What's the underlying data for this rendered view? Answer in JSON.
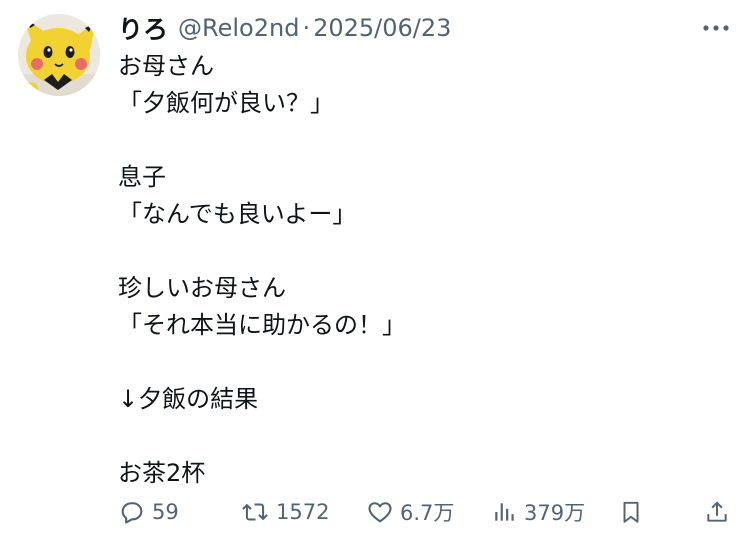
{
  "user": {
    "display_name": "りろ",
    "handle": "@Relo2nd",
    "separator": "·",
    "date": "2025/06/23"
  },
  "tweet": {
    "paragraphs": [
      [
        "お母さん",
        "「夕飯何が良い？」"
      ],
      [
        "息子",
        "「なんでも良いよー」"
      ],
      [
        "珍しいお母さん",
        "「それ本当に助かるの！」"
      ],
      [
        "↓夕飯の結果"
      ],
      [
        "お茶2杯"
      ]
    ]
  },
  "actions": {
    "replies": "59",
    "retweets": "1572",
    "likes": "6.7万",
    "views": "379万"
  },
  "icons": {
    "more": "more-horizontal-icon",
    "reply": "reply-bubble-icon",
    "retweet": "retweet-icon",
    "like": "heart-icon",
    "views": "views-bar-chart-icon",
    "bookmark": "bookmark-icon",
    "share": "share-icon"
  },
  "colors": {
    "text": "#0f1419",
    "secondary": "#536471",
    "background": "#ffffff",
    "avatar_character": "#f2d233"
  }
}
